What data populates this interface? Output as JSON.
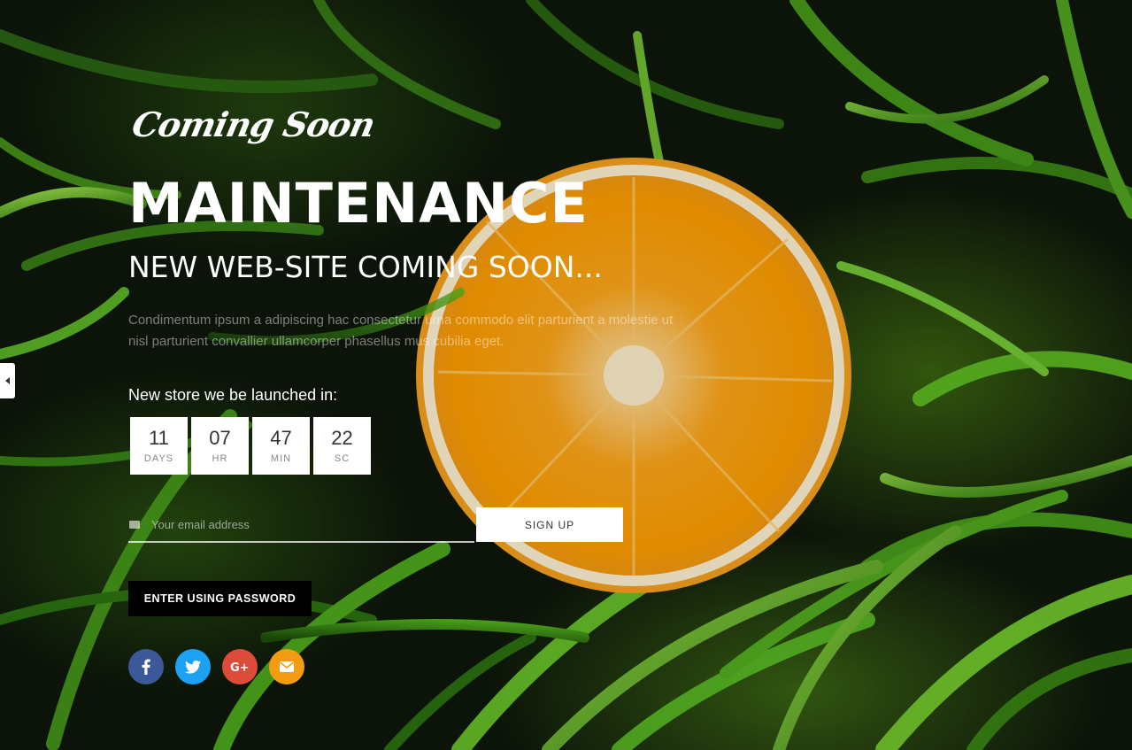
{
  "hero": {
    "logo": "Coming Soon",
    "title": "MAINTENANCE",
    "subtitle": "NEW WEB-SITE COMING SOON...",
    "description": "Condimentum ipsum a adipiscing hac consectetur urna commodo elit parturient a molestie ut nisl parturient convallier ullamcorper phasellus mus cubilia eget."
  },
  "countdown": {
    "label": "New store we be launched in:",
    "items": [
      {
        "value": "11",
        "unit": "DAYS"
      },
      {
        "value": "07",
        "unit": "HR"
      },
      {
        "value": "47",
        "unit": "MIN"
      },
      {
        "value": "22",
        "unit": "SC"
      }
    ]
  },
  "newsletter": {
    "placeholder": "Your email address",
    "button": "SIGN UP"
  },
  "password": {
    "button": "ENTER USING PASSWORD"
  },
  "social": [
    {
      "name": "facebook-icon",
      "color": "#3b5998"
    },
    {
      "name": "twitter-icon",
      "color": "#1da1f2"
    },
    {
      "name": "google-plus-icon",
      "color": "#dd4b39"
    },
    {
      "name": "mail-icon",
      "color": "#f39c12"
    }
  ],
  "colors": {
    "accent": "#f39c12",
    "orange_fruit": "#f7a412"
  }
}
